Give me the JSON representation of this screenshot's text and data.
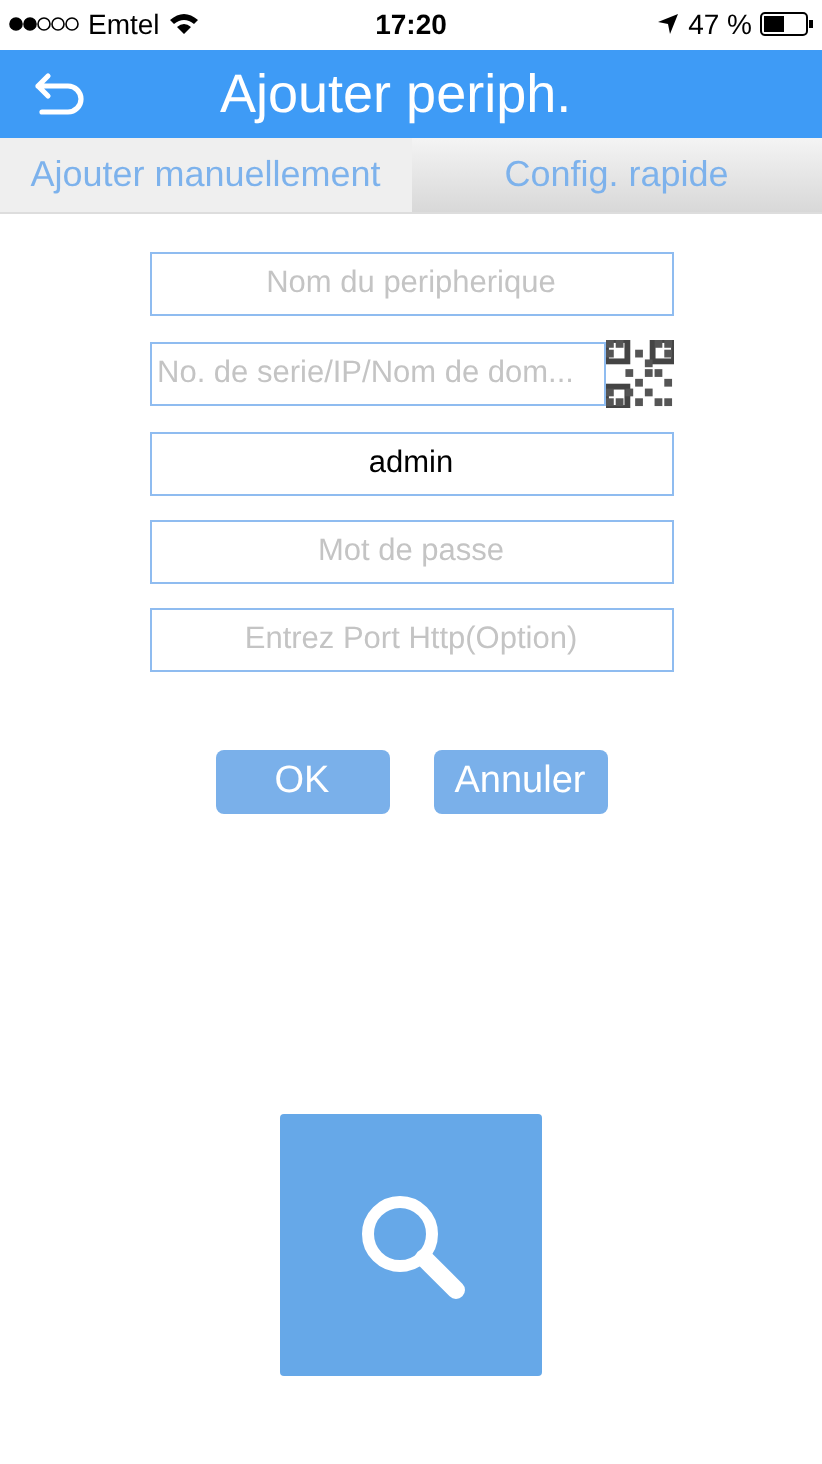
{
  "status_bar": {
    "carrier": "Emtel",
    "time": "17:20",
    "battery": "47 %"
  },
  "header": {
    "title": "Ajouter periph."
  },
  "tabs": [
    {
      "label": "Ajouter manuellement",
      "selected": true
    },
    {
      "label": "Config. rapide",
      "selected": false
    }
  ],
  "fields": [
    {
      "placeholder": "Nom du peripherique"
    },
    {
      "placeholder": "No. de serie/IP/Nom de dom...",
      "qr": true
    },
    {
      "value": "admin"
    },
    {
      "placeholder": "Mot de passe"
    },
    {
      "placeholder": "Entrez Port Http(Option)"
    }
  ],
  "buttons": [
    "OK",
    "Annuler"
  ]
}
